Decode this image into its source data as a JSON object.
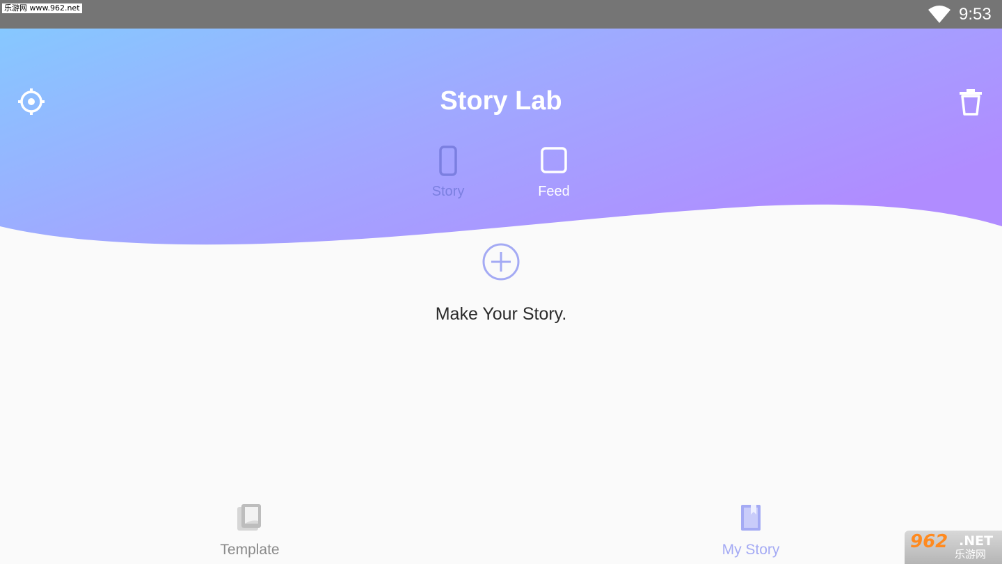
{
  "status_bar": {
    "watermark_text": "乐游网 www.962.net",
    "wifi_icon": "wifi-icon",
    "time": "9:53"
  },
  "header": {
    "title": "Story Lab",
    "settings_icon": "settings-icon",
    "trash_icon": "trash-icon",
    "gradient_colors": [
      "#86c8ff",
      "#9eaaff",
      "#b18cff"
    ],
    "tabs": [
      {
        "label": "Story",
        "icon": "portrait-frame-icon",
        "selected": true
      },
      {
        "label": "Feed",
        "icon": "square-frame-icon",
        "selected": false
      }
    ]
  },
  "main": {
    "add_icon": "plus-circle-icon",
    "prompt": "Make Your Story."
  },
  "bottom_nav": [
    {
      "label": "Template",
      "icon": "template-icon",
      "selected": false
    },
    {
      "label": "My Story",
      "icon": "bookmark-book-icon",
      "selected": true
    }
  ],
  "watermark_corner": {
    "number": "962",
    "suffix": ".NET",
    "chinese": "乐游网"
  },
  "colors": {
    "accent": "#a4aaf4",
    "status_bar": "#757575",
    "background": "#fafafa"
  }
}
